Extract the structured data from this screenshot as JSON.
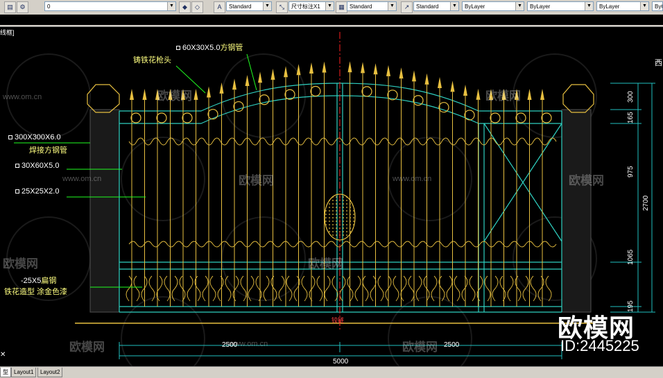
{
  "toolbar": {
    "standard_style": "Standard",
    "dim_style": "尺寸标注X1",
    "table_style": "Standard",
    "multileader_style": "Standard",
    "layer_color": "ByLayer",
    "layer_linetype": "ByLayer",
    "layer_lineweight": "ByLayer",
    "layer_current": "0",
    "plot_style": "ByCo"
  },
  "viewport_label": "线框]",
  "labels": {
    "spear_head": "铸铁花枪头",
    "tube_top": "60X30X5.0",
    "tube_top_suffix": "方钢管",
    "post_size": "300X300X6.0",
    "post_desc": "焊接方钢管",
    "frame_size": "30X60X5.0",
    "bar_size": "25X25X2.0",
    "flat_steel": "-25X5",
    "flat_steel_suffix": "扁钢",
    "casting_desc": "铁花造型 涂金色漆",
    "center_mark": "铰链"
  },
  "dimensions": {
    "d300": "300",
    "d165": "165",
    "d975": "975",
    "d2700": "2700",
    "d1065": "1065",
    "d195": "195",
    "left_width": "2500",
    "right_width": "2500",
    "total_width": "5000"
  },
  "side_text": "西",
  "tabs": [
    "型",
    "Layout1",
    "Layout2"
  ],
  "watermark": {
    "brand": "欧模网",
    "id": "ID:2445225",
    "url": "www.om.cn"
  },
  "colors": {
    "gate_frame": "#2fd0c0",
    "ornament": "#e8c040",
    "leader": "#20ff20",
    "dim_line": "#20c0c0",
    "center_line": "#ff2020"
  }
}
